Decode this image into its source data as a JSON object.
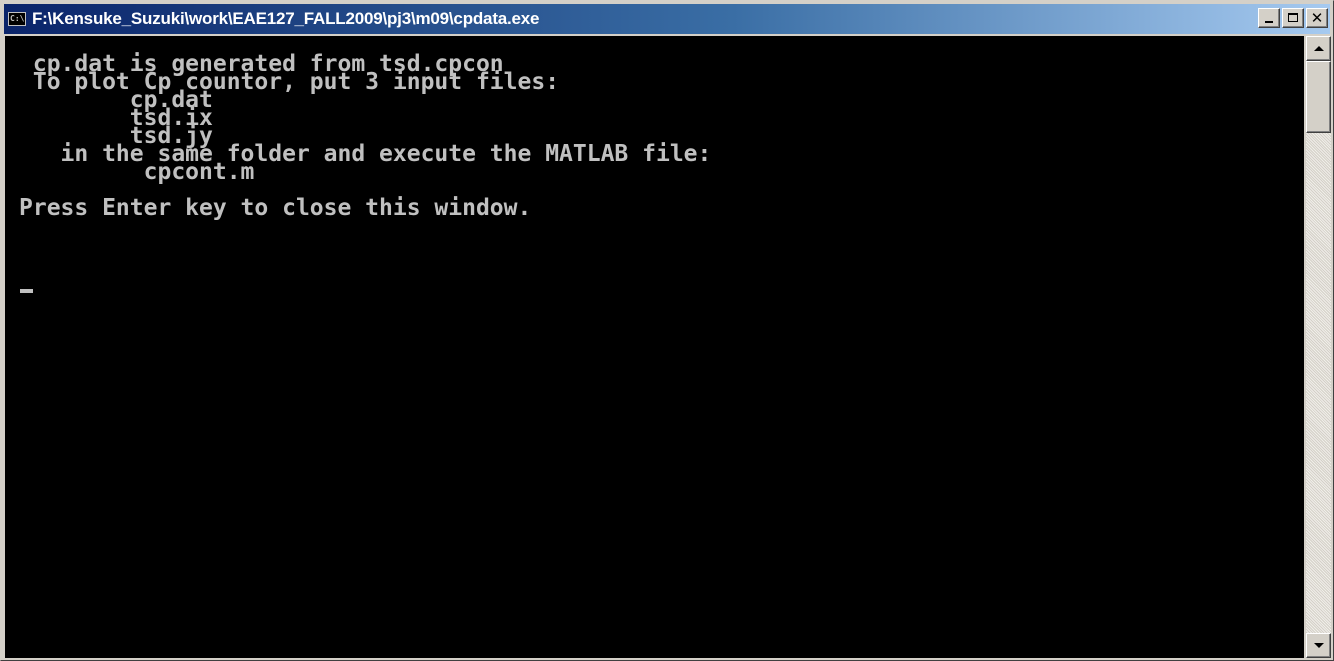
{
  "window": {
    "title": "F:\\Kensuke_Suzuki\\work\\EAE127_FALL2009\\pj3\\m09\\cpdata.exe",
    "icon": "C:\\"
  },
  "console": {
    "output": " cp.dat is generated from tsd.cpcon\n To plot Cp countor, put 3 input files:\n        cp.dat\n        tsd.ix\n        tsd.jy\n   in the same folder and execute the MATLAB file:\n         cpcont.m\n\nPress Enter key to close this window."
  },
  "controls": {
    "close_glyph": "✕"
  },
  "colors": {
    "console_bg": "#000000",
    "console_fg": "#c0c0c0",
    "title_active_start": "#0a246a",
    "title_active_end": "#a6caf0"
  }
}
